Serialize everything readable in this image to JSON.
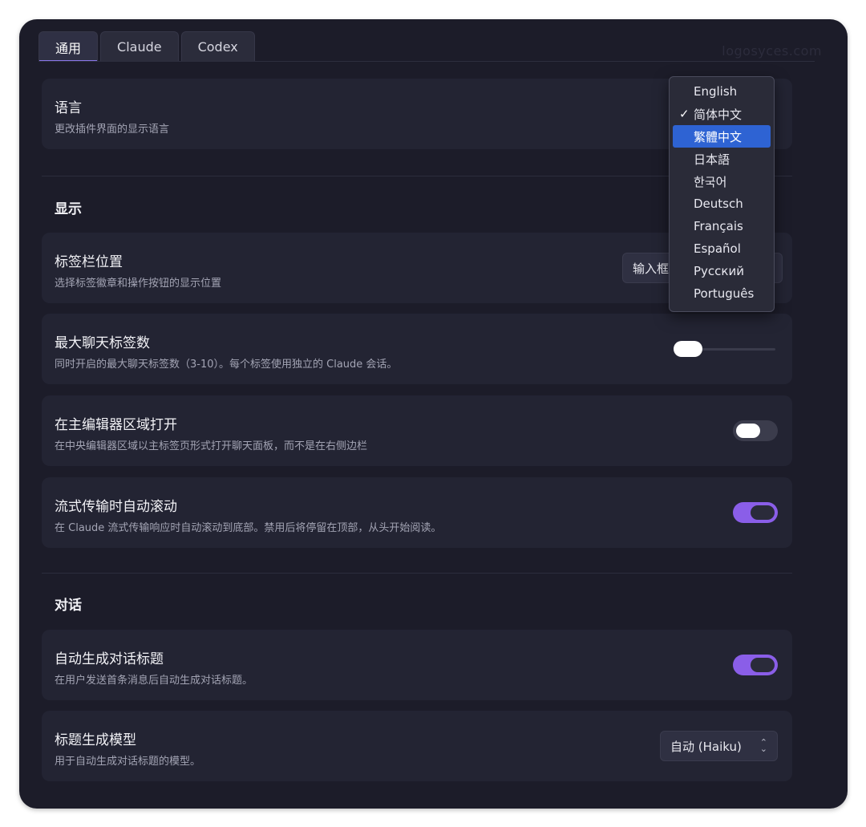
{
  "watermark": "logosyces.com",
  "tabs": [
    {
      "label": "通用",
      "active": true
    },
    {
      "label": "Claude",
      "active": false
    },
    {
      "label": "Codex",
      "active": false
    }
  ],
  "language": {
    "title": "语言",
    "desc": "更改插件界面的显示语言"
  },
  "display": {
    "section_title": "显示",
    "tabbar_position": {
      "title": "标签栏位置",
      "desc": "选择标签徽章和操作按钮的显示位置",
      "value": "输入框"
    },
    "max_tabs": {
      "title": "最大聊天标签数",
      "desc": "同时开启的最大聊天标签数（3-10）。每个标签使用独立的 Claude 会话。",
      "slider_fraction": 0.0
    },
    "open_in_main_editor": {
      "title": "在主编辑器区域打开",
      "desc": "在中央编辑器区域以主标签页形式打开聊天面板，而不是在右侧边栏",
      "enabled": false
    },
    "auto_scroll": {
      "title": "流式传输时自动滚动",
      "desc": "在 Claude 流式传输响应时自动滚动到底部。禁用后将停留在顶部，从头开始阅读。",
      "enabled": true
    }
  },
  "conversation": {
    "section_title": "对话",
    "auto_title": {
      "title": "自动生成对话标题",
      "desc": "在用户发送首条消息后自动生成对话标题。",
      "enabled": true
    },
    "title_model": {
      "title": "标题生成模型",
      "desc": "用于自动生成对话标题的模型。",
      "value": "自动 (Haiku)"
    }
  },
  "language_dropdown": {
    "checked": "简体中文",
    "highlighted": "繁體中文",
    "options": [
      "English",
      "简体中文",
      "繁體中文",
      "日本語",
      "한국어",
      "Deutsch",
      "Français",
      "Español",
      "Русский",
      "Português"
    ]
  },
  "colors": {
    "background": "#1c1c29",
    "card": "#232433",
    "accent": "#8a5ee8",
    "highlight": "#2e63d3"
  }
}
